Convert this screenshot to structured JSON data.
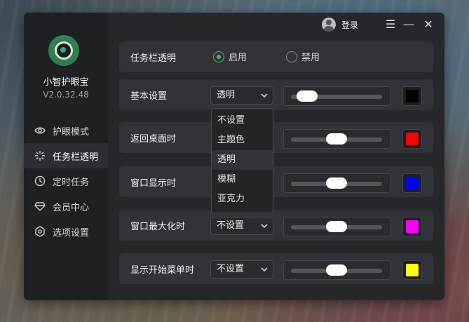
{
  "app": {
    "name": "小智护眼宝",
    "version": "V2.0.32.48"
  },
  "titlebar": {
    "login_label": "登录"
  },
  "sidebar": {
    "items": [
      {
        "label": "护眼模式",
        "icon": "eye-icon"
      },
      {
        "label": "任务栏透明",
        "icon": "sparkle-icon"
      },
      {
        "label": "定时任务",
        "icon": "clock-icon"
      },
      {
        "label": "会员中心",
        "icon": "diamond-icon"
      },
      {
        "label": "选项设置",
        "icon": "hexagon-settings-icon"
      }
    ],
    "active_index": 1
  },
  "main": {
    "toggle_row": {
      "label": "任务栏透明",
      "options": [
        "启用",
        "禁用"
      ],
      "selected": "启用"
    },
    "rows": [
      {
        "label": "基本设置",
        "mode": "透明",
        "slider_fraction": 0.08,
        "color": "#000000"
      },
      {
        "label": "返回桌面时",
        "mode": "",
        "slider_fraction": 0.5,
        "color": "#ff0000"
      },
      {
        "label": "窗口显示时",
        "mode": "",
        "slider_fraction": 0.5,
        "color": "#0000ff"
      },
      {
        "label": "窗口最大化时",
        "mode": "不设置",
        "slider_fraction": 0.5,
        "color": "#ff00ff"
      },
      {
        "label": "显示开始菜单时",
        "mode": "不设置",
        "slider_fraction": 0.5,
        "color": "#ffff00"
      }
    ],
    "dropdown": {
      "options": [
        "不设置",
        "主题色",
        "透明",
        "模糊",
        "亚克力"
      ],
      "highlighted": "透明"
    }
  },
  "colors": {
    "accent": "#3cbf69",
    "window_bg": "#26272b",
    "sidebar_bg": "#1f2024",
    "row_bg": "#323338"
  }
}
